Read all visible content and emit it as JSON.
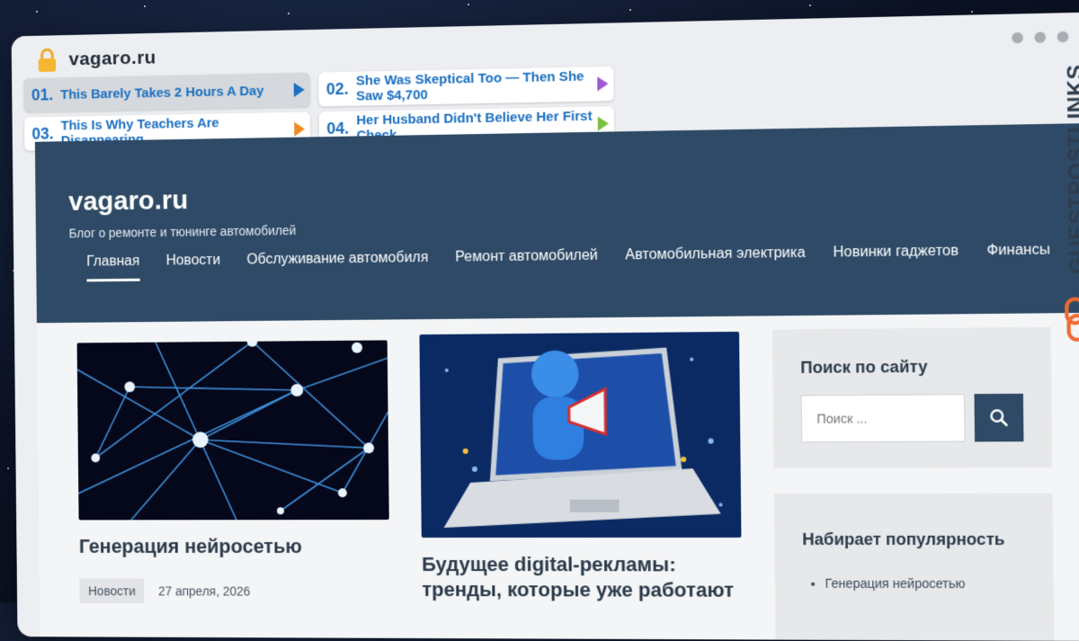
{
  "browser": {
    "url": "vagaro.ru",
    "icons": {
      "lock": "lock-icon",
      "window_dots": "window-control-dots"
    }
  },
  "ads": [
    {
      "num": "01.",
      "text": "This Barely Takes 2 Hours A Day",
      "arrow_color": "#1a6fc0",
      "highlighted": true
    },
    {
      "num": "02.",
      "text": "She Was Skeptical Too — Then She Saw $4,700",
      "arrow_color": "#9b59d0",
      "highlighted": false
    },
    {
      "num": "03.",
      "text": "This Is Why Teachers Are Disappearing",
      "arrow_color": "#f08a24",
      "highlighted": false
    },
    {
      "num": "04.",
      "text": "Her Husband Didn't Believe Her First Check",
      "arrow_color": "#7cc043",
      "highlighted": false
    }
  ],
  "site": {
    "title": "vagaro.ru",
    "description": "Блог о ремонте и тюнинге автомобилей",
    "header_color": "#2e4a66",
    "nav": [
      "Главная",
      "Новости",
      "Обслуживание автомобиля",
      "Ремонт автомобилей",
      "Автомобильная электрика",
      "Новинки гаджетов",
      "Финансы"
    ]
  },
  "posts": [
    {
      "title": "Генерация нейросетью",
      "category": "Новости",
      "date": "27 апреля, 2026",
      "image": "neural-network-image"
    },
    {
      "title": "Будущее digital-рекламы: тренды, которые уже работают",
      "image": "laptop-megaphone-image"
    }
  ],
  "sidebar": {
    "search": {
      "title": "Поиск по сайту",
      "placeholder": "Поиск ...",
      "icon": "search-icon"
    },
    "popular": {
      "title": "Набирает популярность",
      "items": [
        "Генерация нейросетью"
      ]
    }
  },
  "branding": {
    "text": "GUESTPOSTLINKS",
    "icon": "link-chain-icon",
    "accent": "#f06a30"
  }
}
